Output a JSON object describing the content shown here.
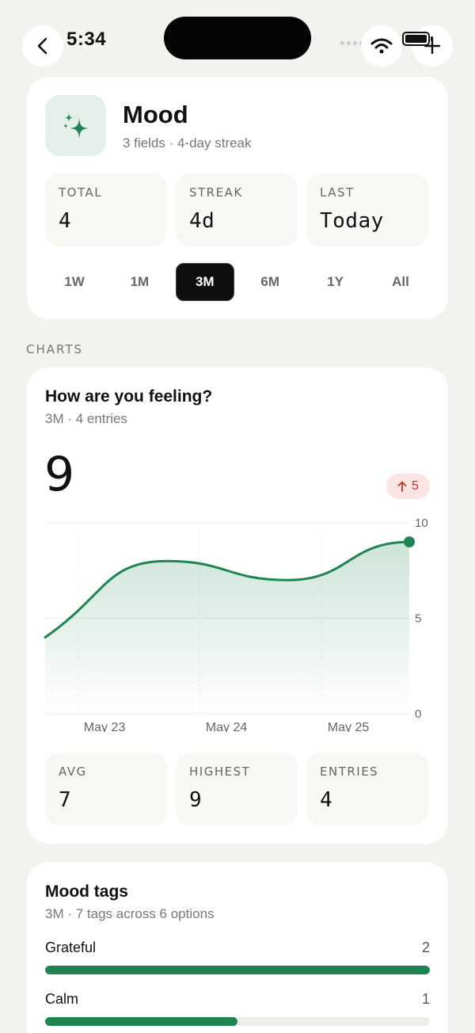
{
  "status": {
    "time": "5:34"
  },
  "header": {
    "title": "Mood",
    "subtitle": "3 fields · 4-day streak",
    "stats": [
      {
        "label": "TOTAL",
        "value": "4"
      },
      {
        "label": "STREAK",
        "value": "4d"
      },
      {
        "label": "LAST",
        "value": "Today"
      }
    ],
    "ranges": [
      "1W",
      "1M",
      "3M",
      "6M",
      "1Y",
      "All"
    ],
    "active_range": "3M"
  },
  "section_label": "CHARTS",
  "chart_card": {
    "title": "How are you feeling?",
    "subtitle": "3M · 4 entries",
    "current_value": "9",
    "change": "5",
    "stats": [
      {
        "label": "AVG",
        "value": "7"
      },
      {
        "label": "HIGHEST",
        "value": "9"
      },
      {
        "label": "ENTRIES",
        "value": "4"
      }
    ]
  },
  "chart_data": {
    "type": "area",
    "x_labels": [
      "May 23",
      "May 24",
      "May 25"
    ],
    "y_ticks": [
      "10",
      "5",
      "0"
    ],
    "ylim": [
      0,
      10
    ],
    "points": [
      {
        "x": 0,
        "y": 4
      },
      {
        "x": 1,
        "y": 8
      },
      {
        "x": 2,
        "y": 7
      },
      {
        "x": 3,
        "y": 9
      }
    ],
    "grid": true,
    "color": "#1e8451"
  },
  "tags_card": {
    "title": "Mood tags",
    "subtitle": "3M · 7 tags across 6 options",
    "tags": [
      {
        "label": "Grateful",
        "count": "2",
        "fraction": 1.0
      },
      {
        "label": "Calm",
        "count": "1",
        "fraction": 0.5
      }
    ]
  },
  "colors": {
    "accent": "#1e8451",
    "background": "#f3f2ee",
    "badge_red": "#c9302c"
  },
  "icons": [
    "back-chevron-icon",
    "wifi-icon",
    "battery-icon",
    "plus-icon",
    "sparkle-icon",
    "arrow-up-icon"
  ]
}
